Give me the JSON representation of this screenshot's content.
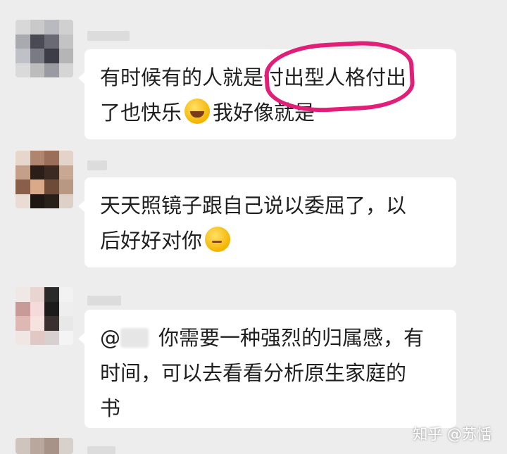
{
  "messages": [
    {
      "lines": [
        "有时候有的人就是付出型人格付出",
        "了也快乐",
        "我好像就是"
      ],
      "emoji": "laughing-tears-emoji",
      "highlighted": "付出型人格"
    },
    {
      "lines": [
        "天天照镜子跟自己说以委屈了，以",
        "后好好对你"
      ],
      "emoji": "thinking-face-emoji"
    },
    {
      "mention": "@",
      "lines": [
        "你需要一种强烈的归属感，有",
        "时间，可以去看看分析原生家庭的",
        "书"
      ]
    }
  ],
  "watermark": "知乎 @苏恬",
  "colors": {
    "highlight_circle": "#e21f78",
    "bubble": "#ffffff",
    "background": "#ededed"
  }
}
